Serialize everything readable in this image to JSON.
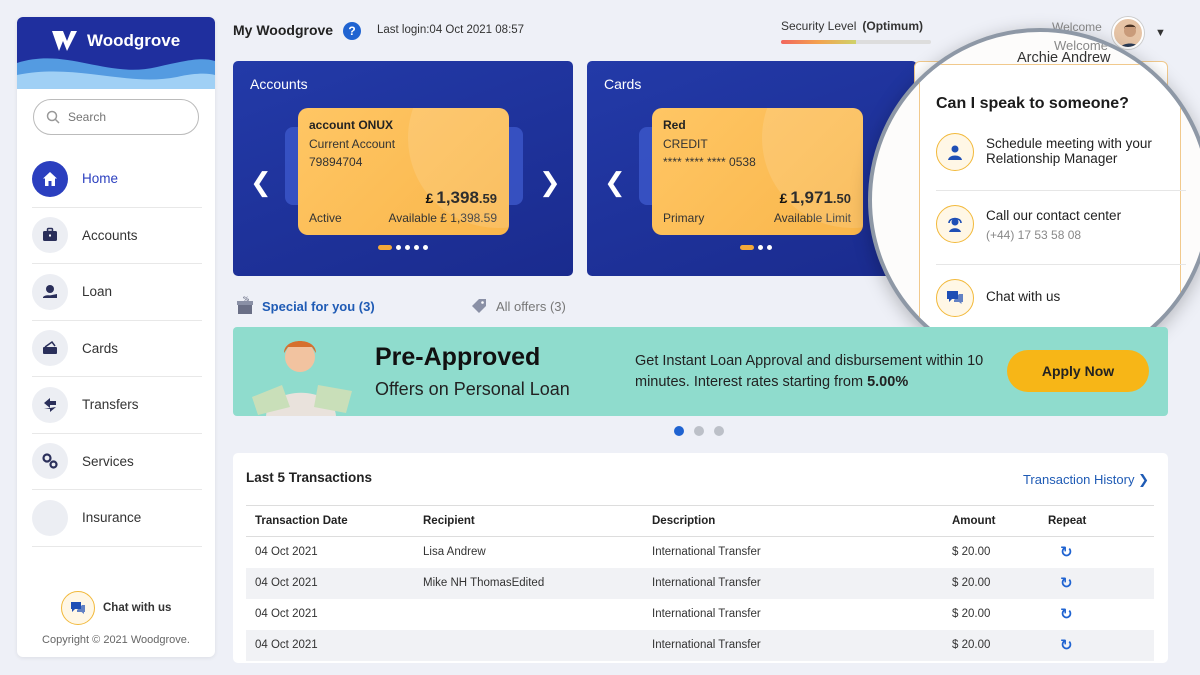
{
  "brand": {
    "name": "Woodgrove"
  },
  "search": {
    "placeholder": "Search"
  },
  "sidebar": {
    "items": [
      {
        "label": "Home",
        "icon": "home-icon"
      },
      {
        "label": "Accounts",
        "icon": "briefcase-icon"
      },
      {
        "label": "Loan",
        "icon": "loan-icon"
      },
      {
        "label": "Cards",
        "icon": "card-icon"
      },
      {
        "label": "Transfers",
        "icon": "transfer-icon"
      },
      {
        "label": "Services",
        "icon": "services-icon"
      },
      {
        "label": "Insurance",
        "icon": "insurance-icon"
      }
    ],
    "chat_label": "Chat with us",
    "copyright": "Copyright © 2021 Woodgrove."
  },
  "header": {
    "title": "My Woodgrove",
    "last_login": "Last login:04 Oct 2021 08:57",
    "security_label": "Security Level",
    "security_value": "(Optimum)",
    "welcome": "Welcome",
    "user_name": "Archie Andrew"
  },
  "accounts": {
    "title": "Accounts",
    "card": {
      "name": "account ONUX",
      "type": "Current Account",
      "number": "79894704",
      "currency": "£",
      "balance_main": "1,398",
      "balance_dec": ".59",
      "status": "Active",
      "available": "Available £ 1,398.59"
    }
  },
  "cards": {
    "title": "Cards",
    "card": {
      "name": "Red",
      "type": "CREDIT",
      "number": "**** **** **** 0538",
      "currency": "£",
      "balance_main": "1,971",
      "balance_dec": ".50",
      "status": "Primary",
      "available": "Available Limit"
    }
  },
  "contact": {
    "title": "Can I speak to someone?",
    "options": [
      {
        "label": "Schedule meeting with your Relationship Manager",
        "sub": ""
      },
      {
        "label": "Call our contact center",
        "sub": "(+44) 17 53 58 08"
      },
      {
        "label": "Chat with us",
        "sub": ""
      }
    ]
  },
  "offers": {
    "tab_special": "Special for you (3)",
    "tab_all": "All offers (3)"
  },
  "banner": {
    "title": "Pre-Approved",
    "subtitle": "Offers on Personal Loan",
    "desc_pre": "Get Instant Loan Approval and disbursement within 10 minutes. Interest rates starting from ",
    "desc_rate": "5.00%",
    "cta": "Apply Now"
  },
  "transactions": {
    "title": "Last 5 Transactions",
    "history_link": "Transaction History",
    "columns": [
      "Transaction Date",
      "Recipient",
      "Description",
      "Amount",
      "Repeat"
    ],
    "rows": [
      {
        "date": "04 Oct 2021",
        "recipient": "Lisa Andrew",
        "description": "International Transfer",
        "amount": "$ 20.00"
      },
      {
        "date": "04 Oct 2021",
        "recipient": "Mike NH ThomasEdited",
        "description": "International Transfer",
        "amount": "$ 20.00"
      },
      {
        "date": "04 Oct 2021",
        "recipient": "",
        "description": "International Transfer",
        "amount": "$ 20.00"
      },
      {
        "date": "04 Oct 2021",
        "recipient": "",
        "description": "International Transfer",
        "amount": "$ 20.00"
      }
    ]
  },
  "colors": {
    "primary": "#1f2f9e",
    "accent": "#f7b617",
    "link": "#1f5bb5",
    "banner": "#8fdccd"
  }
}
